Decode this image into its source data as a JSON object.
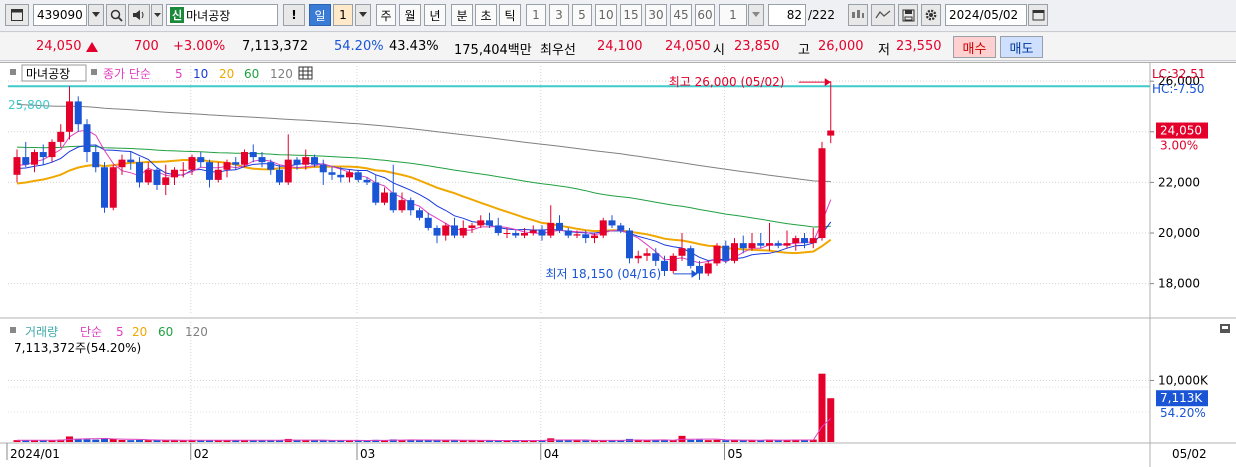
{
  "toolbar": {
    "code": "439090",
    "badge": "신",
    "stock_name": "마녀공장",
    "excl": "!",
    "periods": [
      "일",
      "1",
      "주",
      "월",
      "년",
      "분",
      "초",
      "틱"
    ],
    "intervals": [
      "1",
      "3",
      "5",
      "10",
      "15",
      "30",
      "45",
      "60"
    ],
    "interval_value": "1",
    "page_count": "82",
    "page_total": "/222",
    "date": "2024/05/02"
  },
  "quote": {
    "price": "24,050",
    "change": "700",
    "change_pct": "+3.00%",
    "volume": "7,113,372",
    "volume_pct": "54.20%",
    "turnover_pct": "43.43%",
    "amount": "175,404백만",
    "best_label": "최우선",
    "best_ask": "24,100",
    "best_bid": "24,050",
    "open_label": "시",
    "open": "23,850",
    "high_label": "고",
    "high": "26,000",
    "low_label": "저",
    "low": "23,550",
    "buy": "매수",
    "sell": "매도"
  },
  "colors": {
    "up": "#e4002b",
    "down": "#1a55d6",
    "ma5": "#e040c0",
    "ma10": "#1a3adb",
    "ma20": "#f0a800",
    "ma60": "#20a040",
    "ma120": "#808080",
    "hline": "#3fc9c9"
  },
  "chart_data": [
    {
      "type": "candlestick",
      "legend": {
        "name": "마녀공장",
        "series_label": "종가 단순",
        "periods": [
          "5",
          "10",
          "20",
          "60",
          "120"
        ]
      },
      "ylim": [
        16800,
        26600
      ],
      "yticks": [
        18000,
        20000,
        22000,
        24000,
        26000
      ],
      "ytick_labels": [
        "18,000",
        "20,000",
        "22,000",
        "24,000",
        "26,000"
      ],
      "hline": {
        "value": 25800,
        "label": "25,800"
      },
      "lc": "LC:32.51",
      "hc": "HC:-7.50",
      "price_tag": "24,050",
      "price_tag_pct": "3.00%",
      "max_annotation": "최고 26,000 (05/02)",
      "min_annotation": "최저 18,150 (04/16)",
      "x_labels": [
        {
          "index": 0,
          "label": "2024/01"
        },
        {
          "index": 21,
          "label": "02"
        },
        {
          "index": 40,
          "label": "03"
        },
        {
          "index": 61,
          "label": "04"
        },
        {
          "index": 82,
          "label": "05"
        }
      ],
      "ohlc": [
        [
          22300,
          23300,
          22000,
          23000
        ],
        [
          23000,
          23600,
          22600,
          22700
        ],
        [
          22700,
          23300,
          22400,
          23200
        ],
        [
          23200,
          23500,
          22700,
          23000
        ],
        [
          23000,
          23700,
          22800,
          23600
        ],
        [
          23600,
          24300,
          23400,
          24000
        ],
        [
          24000,
          25800,
          23700,
          25200
        ],
        [
          25200,
          25400,
          24000,
          24300
        ],
        [
          24300,
          24500,
          22800,
          23200
        ],
        [
          23200,
          23500,
          22400,
          22600
        ],
        [
          22600,
          22800,
          20800,
          21000
        ],
        [
          21000,
          22700,
          20900,
          22600
        ],
        [
          22600,
          23100,
          22300,
          22900
        ],
        [
          22900,
          23200,
          22500,
          22800
        ],
        [
          22800,
          23000,
          21800,
          22000
        ],
        [
          22000,
          22800,
          21900,
          22500
        ],
        [
          22500,
          22600,
          21700,
          21900
        ],
        [
          21900,
          22700,
          21500,
          22200
        ],
        [
          22200,
          22600,
          21900,
          22500
        ],
        [
          22500,
          22800,
          22200,
          22500
        ],
        [
          22500,
          23100,
          22300,
          23000
        ],
        [
          23000,
          23200,
          22600,
          22800
        ],
        [
          22800,
          22900,
          21800,
          22100
        ],
        [
          22100,
          22800,
          22000,
          22500
        ],
        [
          22500,
          22900,
          22200,
          22800
        ],
        [
          22800,
          23000,
          22500,
          22700
        ],
        [
          22700,
          23300,
          22600,
          23200
        ],
        [
          23200,
          23500,
          22800,
          23000
        ],
        [
          23000,
          23200,
          22600,
          22800
        ],
        [
          22800,
          22900,
          22300,
          22500
        ],
        [
          22500,
          22700,
          21900,
          22000
        ],
        [
          22000,
          23900,
          21900,
          22900
        ],
        [
          22900,
          23000,
          22500,
          22700
        ],
        [
          22700,
          23300,
          22500,
          23000
        ],
        [
          23000,
          23100,
          22600,
          22700
        ],
        [
          22700,
          22900,
          21900,
          22400
        ],
        [
          22400,
          22600,
          22100,
          22300
        ],
        [
          22300,
          22600,
          22000,
          22200
        ],
        [
          22200,
          22500,
          22000,
          22400
        ],
        [
          22400,
          22500,
          22000,
          22100
        ],
        [
          22100,
          22200,
          21900,
          22000
        ],
        [
          22000,
          22300,
          21100,
          21200
        ],
        [
          21200,
          21800,
          21100,
          21600
        ],
        [
          21600,
          22700,
          20800,
          20900
        ],
        [
          20900,
          21600,
          20800,
          21300
        ],
        [
          21300,
          21400,
          20700,
          20900
        ],
        [
          20900,
          21000,
          20500,
          20600
        ],
        [
          20600,
          20800,
          20100,
          20200
        ],
        [
          20200,
          20300,
          19600,
          19900
        ],
        [
          19900,
          20400,
          19700,
          20300
        ],
        [
          20300,
          20600,
          19800,
          19900
        ],
        [
          19900,
          20500,
          19800,
          20200
        ],
        [
          20200,
          20400,
          20000,
          20300
        ],
        [
          20300,
          20700,
          20200,
          20500
        ],
        [
          20500,
          20800,
          20200,
          20300
        ],
        [
          20300,
          20600,
          19900,
          20000
        ],
        [
          20000,
          20200,
          19800,
          20000
        ],
        [
          20000,
          20100,
          19800,
          19900
        ],
        [
          19900,
          20200,
          19800,
          20000
        ],
        [
          20000,
          20300,
          19900,
          20100
        ],
        [
          20100,
          20300,
          19700,
          19900
        ],
        [
          19900,
          21100,
          19800,
          20400
        ],
        [
          20400,
          20700,
          20000,
          20100
        ],
        [
          20100,
          20200,
          19800,
          19900
        ],
        [
          19900,
          20100,
          19800,
          19950
        ],
        [
          19950,
          20100,
          19600,
          19800
        ],
        [
          19800,
          20000,
          19600,
          19900
        ],
        [
          19900,
          20600,
          19800,
          20500
        ],
        [
          20500,
          20700,
          20200,
          20300
        ],
        [
          20300,
          20400,
          20000,
          20100
        ],
        [
          20100,
          20200,
          18800,
          19000
        ],
        [
          19000,
          19300,
          18800,
          19100
        ],
        [
          19100,
          19400,
          18900,
          19200
        ],
        [
          19200,
          19400,
          18700,
          18900
        ],
        [
          18900,
          19100,
          18300,
          18500
        ],
        [
          18500,
          19200,
          18400,
          19100
        ],
        [
          19100,
          20000,
          18900,
          19400
        ],
        [
          19400,
          19500,
          18600,
          18700
        ],
        [
          18700,
          18900,
          18150,
          18400
        ],
        [
          18400,
          18900,
          18300,
          18800
        ],
        [
          18800,
          19600,
          18700,
          19500
        ],
        [
          19500,
          19700,
          18800,
          18900
        ],
        [
          18900,
          19800,
          18800,
          19600
        ],
        [
          19600,
          19900,
          19200,
          19400
        ],
        [
          19400,
          20000,
          19300,
          19600
        ],
        [
          19600,
          20000,
          19400,
          19500
        ],
        [
          19500,
          20400,
          19300,
          19600
        ],
        [
          19600,
          19700,
          19400,
          19500
        ],
        [
          19500,
          20100,
          19400,
          19600
        ],
        [
          19600,
          19900,
          19300,
          19800
        ],
        [
          19800,
          20000,
          19400,
          19600
        ],
        [
          19600,
          20200,
          19400,
          19800
        ],
        [
          19800,
          23600,
          19700,
          23350
        ],
        [
          23850,
          26000,
          23550,
          24050
        ]
      ]
    },
    {
      "type": "bar",
      "legend": {
        "name": "거래량",
        "series_label": "단순",
        "periods": [
          "5",
          "20",
          "60",
          "120"
        ]
      },
      "info": "7,113,372주(54.20%)",
      "ylim": [
        0,
        13000000
      ],
      "yticks": [
        10000000
      ],
      "ytick_labels": [
        "10,000K"
      ],
      "tag": "7,113K",
      "tag_pct": "54.20%",
      "last_date": "05/02",
      "volume": [
        300000,
        280000,
        260000,
        240000,
        320000,
        380000,
        900000,
        520000,
        450000,
        380000,
        620000,
        550000,
        330000,
        300000,
        340000,
        300000,
        320000,
        290000,
        270000,
        260000,
        330000,
        280000,
        310000,
        270000,
        250000,
        260000,
        300000,
        280000,
        260000,
        250000,
        300000,
        500000,
        270000,
        260000,
        250000,
        300000,
        250000,
        240000,
        230000,
        240000,
        230000,
        350000,
        280000,
        420000,
        300000,
        320000,
        300000,
        310000,
        350000,
        280000,
        270000,
        260000,
        240000,
        250000,
        240000,
        260000,
        240000,
        230000,
        240000,
        230000,
        260000,
        600000,
        300000,
        250000,
        240000,
        230000,
        240000,
        300000,
        250000,
        240000,
        500000,
        300000,
        280000,
        270000,
        320000,
        300000,
        1000000,
        350000,
        380000,
        300000,
        350000,
        290000,
        320000,
        300000,
        280000,
        310000,
        400000,
        290000,
        300000,
        350000,
        310000,
        400000,
        11100000,
        7113372
      ]
    }
  ]
}
